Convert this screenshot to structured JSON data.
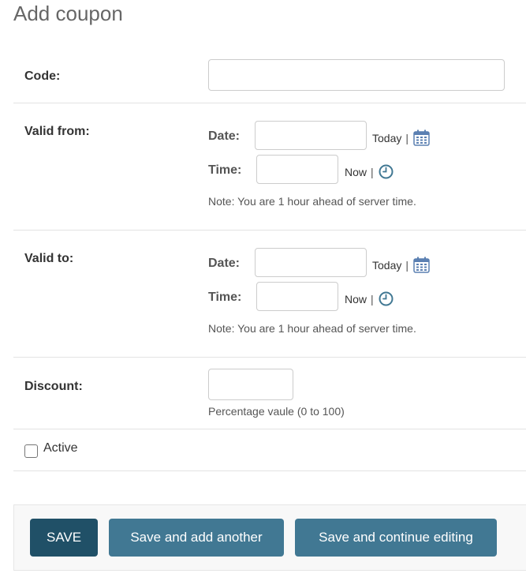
{
  "page": {
    "title": "Add coupon"
  },
  "code": {
    "label": "Code:",
    "value": "",
    "placeholder": ""
  },
  "valid_from": {
    "label": "Valid from:",
    "date_label": "Date:",
    "date_value": "",
    "today_link": "Today",
    "separator": "|",
    "time_label": "Time:",
    "time_value": "",
    "now_link": "Now",
    "note": "Note: You are 1 hour ahead of server time."
  },
  "valid_to": {
    "label": "Valid to:",
    "date_label": "Date:",
    "date_value": "",
    "today_link": "Today",
    "separator": "|",
    "time_label": "Time:",
    "time_value": "",
    "now_link": "Now",
    "note": "Note: You are 1 hour ahead of server time."
  },
  "discount": {
    "label": "Discount:",
    "value": "",
    "help": "Percentage vaule (0 to 100)"
  },
  "active": {
    "label": "Active",
    "checked": false
  },
  "actions": {
    "save": "SAVE",
    "save_add_another": "Save and add another",
    "save_continue": "Save and continue editing"
  },
  "colors": {
    "primary_button": "#205067",
    "secondary_button": "#417893",
    "clock_icon": "#417893",
    "calendar_icon": "#5b80b2"
  }
}
